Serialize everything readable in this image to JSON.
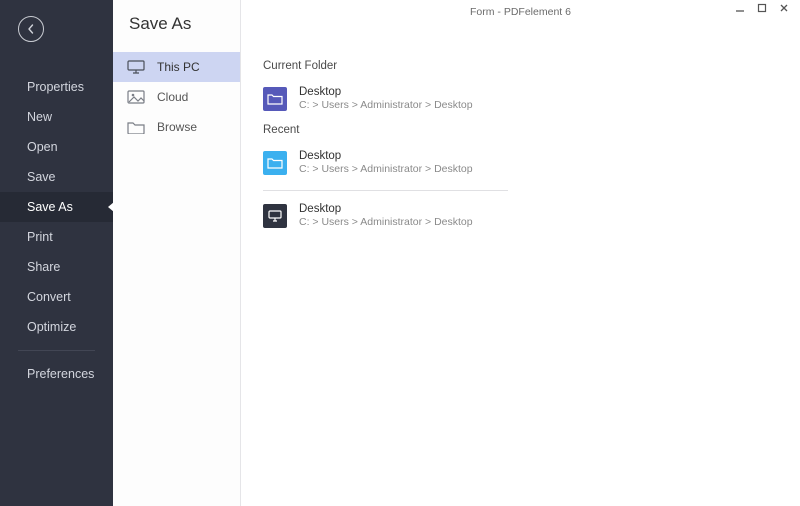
{
  "window": {
    "title": "Form - PDFelement 6"
  },
  "sidebar": {
    "items": [
      {
        "label": "Properties",
        "active": false
      },
      {
        "label": "New",
        "active": false
      },
      {
        "label": "Open",
        "active": false
      },
      {
        "label": "Save",
        "active": false
      },
      {
        "label": "Save As",
        "active": true
      },
      {
        "label": "Print",
        "active": false
      },
      {
        "label": "Share",
        "active": false
      },
      {
        "label": "Convert",
        "active": false
      },
      {
        "label": "Optimize",
        "active": false
      }
    ],
    "preferences_label": "Preferences"
  },
  "page": {
    "title": "Save As"
  },
  "locations": [
    {
      "label": "This PC",
      "icon": "monitor-icon",
      "active": true
    },
    {
      "label": "Cloud",
      "icon": "image-icon",
      "active": false
    },
    {
      "label": "Browse",
      "icon": "folder-icon",
      "active": false
    }
  ],
  "sections": {
    "current_folder_label": "Current Folder",
    "recent_label": "Recent"
  },
  "current_folder": {
    "name": "Desktop",
    "path": "C: > Users > Administrator > Desktop",
    "icon_style": "purple",
    "icon": "folder"
  },
  "recent": [
    {
      "name": "Desktop",
      "path": "C: > Users > Administrator > Desktop",
      "icon_style": "blue",
      "icon": "folder"
    },
    {
      "name": "Desktop",
      "path": "C: > Users > Administrator > Desktop",
      "icon_style": "dark",
      "icon": "monitor"
    }
  ]
}
